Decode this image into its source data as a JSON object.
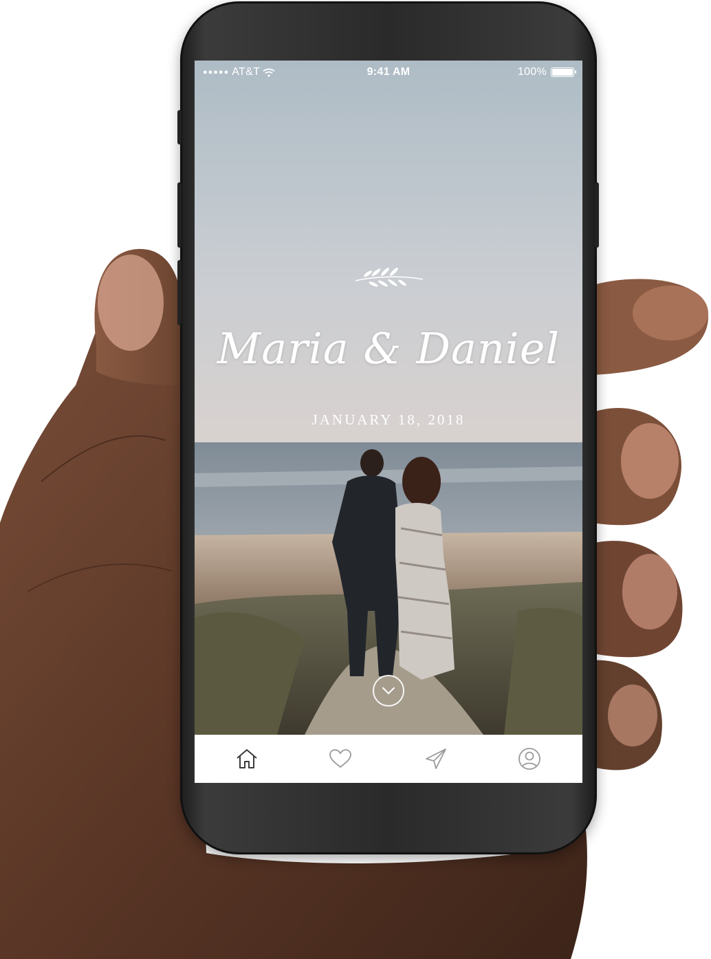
{
  "status_bar": {
    "signal_dots": "●●●●●",
    "carrier": "AT&T",
    "wifi_icon": "wifi-icon",
    "time": "9:41 AM",
    "battery": "100%"
  },
  "hero": {
    "ornament_icon": "laurel-branch-icon",
    "names": "Maria & Daniel",
    "date": "JANUARY 18, 2018",
    "scroll_icon": "chevron-down-icon"
  },
  "tab_bar": {
    "items": [
      {
        "icon": "home-icon",
        "active": true
      },
      {
        "icon": "heart-icon",
        "active": false
      },
      {
        "icon": "send-icon",
        "active": false
      },
      {
        "icon": "profile-icon",
        "active": false
      }
    ]
  },
  "colors": {
    "tab_active": "#3a3a3a",
    "tab_inactive": "#9a9a9a",
    "phone_frame": "#2a2a2a",
    "skin": "#6b4430"
  }
}
